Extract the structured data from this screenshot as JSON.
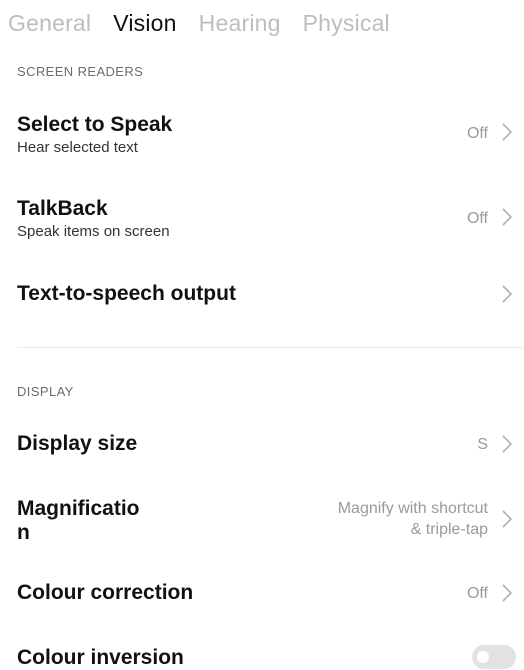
{
  "tabs": [
    {
      "label": "General",
      "active": false
    },
    {
      "label": "Vision",
      "active": true
    },
    {
      "label": "Hearing",
      "active": false
    },
    {
      "label": "Physical",
      "active": false
    }
  ],
  "sections": {
    "screen_readers": "SCREEN READERS",
    "display": "DISPLAY"
  },
  "items": {
    "select_to_speak": {
      "title": "Select to Speak",
      "subtitle": "Hear selected text",
      "value": "Off"
    },
    "talkback": {
      "title": "TalkBack",
      "subtitle": "Speak items on screen",
      "value": "Off"
    },
    "tts_output": {
      "title": "Text-to-speech output"
    },
    "display_size": {
      "title": "Display size",
      "value": "S"
    },
    "magnification": {
      "title_line1": "Magnificatio",
      "title_line2": "n",
      "value_line1": "Magnify with shortcut",
      "value_line2": "& triple-tap"
    },
    "colour_correction": {
      "title": "Colour correction",
      "value": "Off"
    },
    "colour_inversion": {
      "title": "Colour inversion",
      "enabled": false
    }
  },
  "colors": {
    "active_tab": "#111111",
    "inactive_tab": "#bdbdbd",
    "secondary_value": "#9a9a9a",
    "chevron": "#b0b0b0",
    "toggle_track_off": "#e2e2e2"
  },
  "icons": {
    "chevron": "chevron-right-icon"
  }
}
